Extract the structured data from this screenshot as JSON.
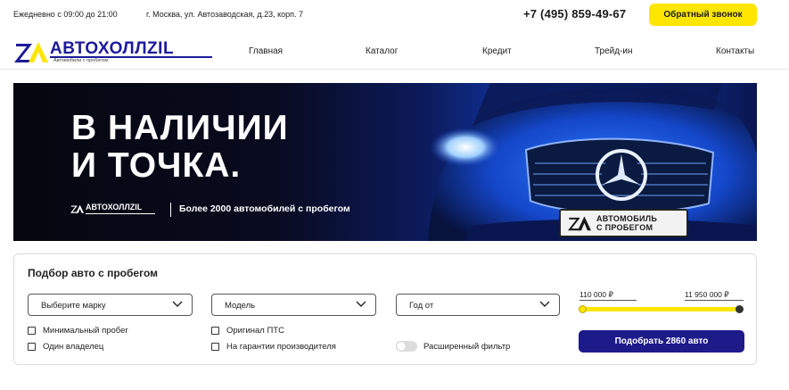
{
  "topbar": {
    "hours": "Ежедневно с 09:00 до 21:00",
    "address": "г. Москва, ул. Автозаводская, д.23, корп. 7",
    "phone": "+7 (495) 859-49-67",
    "callback_label": "Обратный звонок"
  },
  "logo": {
    "brand": "АВТОХОЛЛZIL",
    "tagline": "Автомобили с пробегом"
  },
  "nav": {
    "items": [
      {
        "label": "Главная"
      },
      {
        "label": "Каталог"
      },
      {
        "label": "Кредит"
      },
      {
        "label": "Трейд-ин"
      },
      {
        "label": "Контакты"
      }
    ]
  },
  "hero": {
    "headline_line1": "В НАЛИЧИИ",
    "headline_line2": "И ТОЧКА.",
    "mini_brand": "АВТОХОЛЛZIL",
    "subline": "Более 2000 автомобилей с пробегом",
    "plate_line1": "АВТОМОБИЛЬ",
    "plate_line2": "С ПРОБЕГОМ"
  },
  "filter": {
    "title": "Подбор авто с пробегом",
    "brand_select": "Выберите марку",
    "model_select": "Модель",
    "year_select": "Год от",
    "price_min": "110 000 ₽",
    "price_max": "11 950 000 ₽",
    "checks": [
      {
        "label": "Минимальный пробег"
      },
      {
        "label": "Один владелец"
      },
      {
        "label": "Оригинал ПТС"
      },
      {
        "label": "На гарантии производителя"
      }
    ],
    "extended_filter_label": "Расширенный фильтр",
    "submit_label": "Подобрать 2860 авто"
  },
  "colors": {
    "accent_yellow": "#ffe600",
    "brand_blue": "#1d1a8a"
  }
}
